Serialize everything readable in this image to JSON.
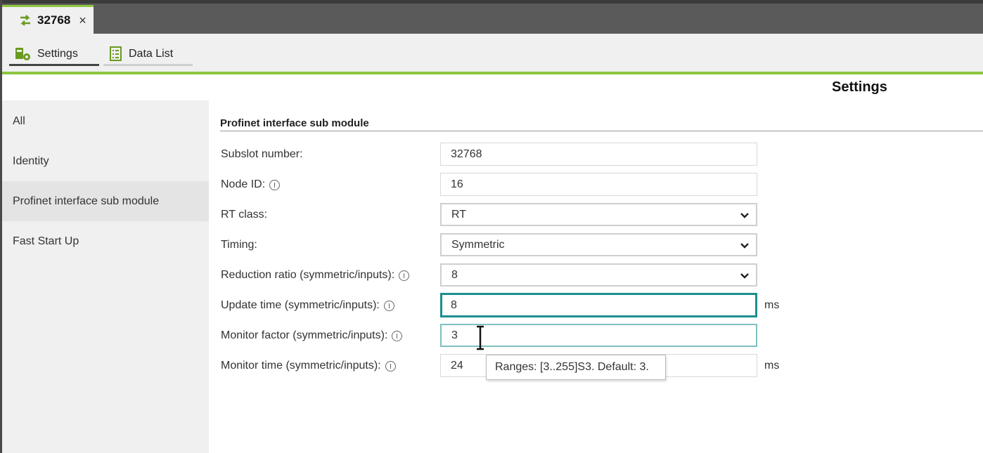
{
  "tab": {
    "title": "32768",
    "close_glyph": "×",
    "icon": "swap-arrows-icon",
    "accent": "#8dc63f"
  },
  "subtabs": [
    {
      "label": "Settings",
      "icon": "settings-gear-icon"
    },
    {
      "label": "Data List",
      "icon": "list-icon"
    }
  ],
  "page_title": "Settings",
  "nav": [
    {
      "label": "All"
    },
    {
      "label": "Identity"
    },
    {
      "label": "Profinet interface sub module"
    },
    {
      "label": "Fast Start Up"
    }
  ],
  "section": {
    "title": "Profinet interface sub module"
  },
  "fields": {
    "subslot": {
      "label": "Subslot number:",
      "value": "32768"
    },
    "node_id": {
      "label": "Node ID:",
      "value": "16"
    },
    "rt_class": {
      "label": "RT class:",
      "value": "RT"
    },
    "timing": {
      "label": "Timing:",
      "value": "Symmetric"
    },
    "reduction": {
      "label": "Reduction ratio (symmetric/inputs):",
      "value": "8"
    },
    "update_time": {
      "label": "Update time (symmetric/inputs):",
      "value": "8",
      "unit": "ms"
    },
    "monitor_factor": {
      "label": "Monitor factor (symmetric/inputs):",
      "value": "3"
    },
    "monitor_time": {
      "label": "Monitor time (symmetric/inputs):",
      "value": "24",
      "unit": "ms"
    }
  },
  "tooltip": {
    "text": "Ranges: [3..255]S3.  Default: 3."
  },
  "colors": {
    "focus_border": "#1d8f8f",
    "accent_green": "#8dc63f"
  }
}
